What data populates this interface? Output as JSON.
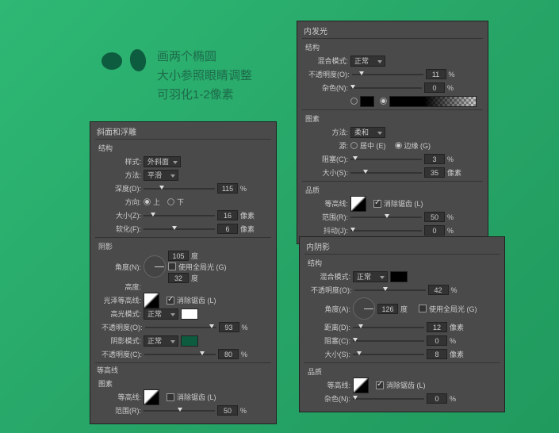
{
  "intro": {
    "line1": "画两个椭圆",
    "line2": "大小参照眼睛调整",
    "line3": "可羽化1-2像素"
  },
  "bevel": {
    "title": "斜面和浮雕",
    "s1": "结构",
    "style_lbl": "样式:",
    "style_val": "外斜面",
    "tech_lbl": "方法:",
    "tech_val": "平滑",
    "depth_lbl": "深度(D):",
    "depth_val": "115",
    "depth_u": "%",
    "dir_lbl": "方向:",
    "dir_up": "上",
    "dir_down": "下",
    "size_lbl": "大小(Z):",
    "size_val": "16",
    "size_u": "像素",
    "soft_lbl": "软化(F):",
    "soft_val": "6",
    "soft_u": "像素",
    "s2": "阴影",
    "angle_lbl": "角度(N):",
    "angle_val": "105",
    "angle_u": "度",
    "global": "使用全局光 (G)",
    "alt_lbl": "高度:",
    "alt_val": "32",
    "alt_u": "度",
    "gloss_lbl": "光泽等高线:",
    "aa": "消除锯齿 (L)",
    "hmode_lbl": "高光模式:",
    "hmode_val": "正常",
    "hop_lbl": "不透明度(O):",
    "hop_val": "93",
    "hop_u": "%",
    "smode_lbl": "阴影模式:",
    "smode_val": "正常",
    "sop_lbl": "不透明度(C):",
    "sop_val": "80",
    "sop_u": "%",
    "s3": "等高线",
    "s3sub": "图素",
    "c_lbl": "等高线:",
    "c_aa": "消除锯齿 (L)",
    "range_lbl": "范围(R):",
    "range_val": "50",
    "range_u": "%"
  },
  "glow": {
    "title": "内发光",
    "s1": "结构",
    "blend_lbl": "混合模式:",
    "blend_val": "正常",
    "op_lbl": "不透明度(O):",
    "op_val": "11",
    "op_u": "%",
    "noise_lbl": "杂色(N):",
    "noise_val": "0",
    "noise_u": "%",
    "s2": "图素",
    "tech_lbl": "方法:",
    "tech_val": "柔和",
    "src_lbl": "源:",
    "src_c": "居中 (E)",
    "src_e": "边缘 (G)",
    "choke_lbl": "阻塞(C):",
    "choke_val": "3",
    "choke_u": "%",
    "size_lbl": "大小(S):",
    "size_val": "35",
    "size_u": "像素",
    "s3": "品质",
    "cont_lbl": "等高线:",
    "aa": "消除锯齿 (L)",
    "range_lbl": "范围(R):",
    "range_val": "50",
    "range_u": "%",
    "jit_lbl": "抖动(J):",
    "jit_val": "0",
    "jit_u": "%"
  },
  "ishadow": {
    "title": "内阴影",
    "s1": "结构",
    "blend_lbl": "混合模式:",
    "blend_val": "正常",
    "op_lbl": "不透明度(O):",
    "op_val": "42",
    "op_u": "%",
    "angle_lbl": "角度(A):",
    "angle_val": "126",
    "angle_u": "度",
    "global": "使用全局光 (G)",
    "dist_lbl": "距离(D):",
    "dist_val": "12",
    "dist_u": "像素",
    "choke_lbl": "阻塞(C):",
    "choke_val": "0",
    "choke_u": "%",
    "size_lbl": "大小(S):",
    "size_val": "8",
    "size_u": "像素",
    "s2": "品质",
    "cont_lbl": "等高线:",
    "aa": "消除锯齿 (L)",
    "noise_lbl": "杂色(N):",
    "noise_val": "0",
    "noise_u": "%"
  }
}
